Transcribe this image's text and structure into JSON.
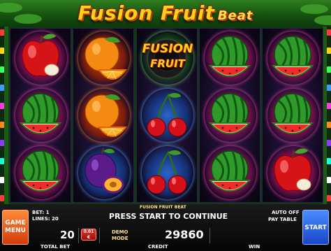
{
  "game": {
    "title": "Fusion Fruit",
    "subtitle": "Beat",
    "logo_line1": "FUSION",
    "logo_line2": "FRUIT"
  },
  "reels": [
    [
      "apple",
      "watermelon",
      "watermelon"
    ],
    [
      "orange",
      "orange",
      "plum"
    ],
    [
      "fusion-fruit-logo",
      "cherry",
      "cherry"
    ],
    [
      "watermelon",
      "watermelon",
      "watermelon"
    ],
    [
      "watermelon",
      "watermelon",
      "apple"
    ]
  ],
  "panel": {
    "game_name": "FUSION FRUIT BEAT",
    "message": "PRESS START TO CONTINUE",
    "bet_label": "BET: 1",
    "lines_label": "LINES: 20",
    "total_bet_value": "20",
    "total_bet_label": "TOTAL BET",
    "coin_value": "0.01",
    "coin_currency": "€",
    "demo_line1": "DEMO",
    "demo_line2": "MODE",
    "credit_value": "29860",
    "credit_label": "CREDIT",
    "win_label": "WIN",
    "auto_label": "AUTO OFF",
    "paytable_label": "PAY TABLE",
    "menu_line1": "GAME",
    "menu_line2": "MENU",
    "start_label": "START"
  },
  "colors": {
    "title": "#ffd21a",
    "menu_button": "#e5561a",
    "start_button": "#2a5fe0"
  }
}
